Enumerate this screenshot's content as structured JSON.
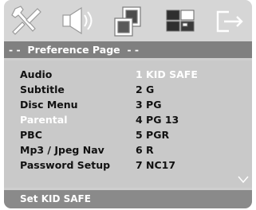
{
  "icons": [
    "wrench-screwdriver-icon",
    "speaker-icon",
    "video-icon",
    "preferences-icon",
    "exit-icon"
  ],
  "header": {
    "title": "- -  Preference Page  - -"
  },
  "menu": {
    "items": [
      {
        "label": "Audio",
        "value": "1 KID SAFE"
      },
      {
        "label": "Subtitle",
        "value": "2 G"
      },
      {
        "label": "Disc Menu",
        "value": "3 PG"
      },
      {
        "label": "Parental",
        "value": "4 PG 13"
      },
      {
        "label": "PBC",
        "value": "5 PGR"
      },
      {
        "label": "Mp3 / Jpeg Nav",
        "value": "6 R"
      },
      {
        "label": "Password Setup",
        "value": "7 NC17"
      }
    ],
    "highlighted_label_index": 3,
    "highlighted_value_index": 0
  },
  "footer": {
    "text": "Set KID SAFE"
  },
  "colors": {
    "highlight": "#ffffff",
    "header_bg": "#808080",
    "panel_bg": "#c9c9c9"
  }
}
